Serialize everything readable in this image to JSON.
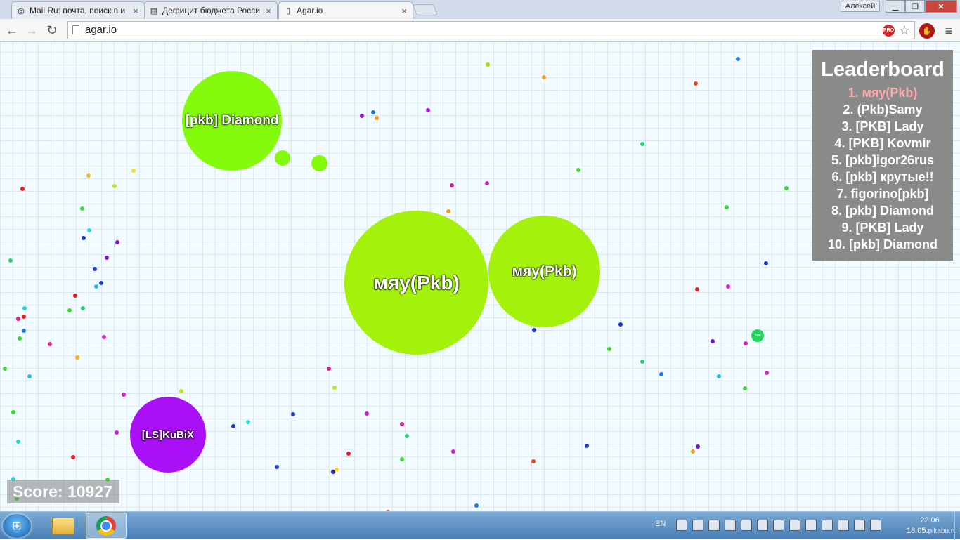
{
  "browser": {
    "tabs": [
      {
        "title": "Mail.Ru: почта, поиск в и",
        "active": false
      },
      {
        "title": "Дефицит бюджета Росси",
        "active": false
      },
      {
        "title": "Agar.io",
        "active": true
      }
    ],
    "profile_name": "Алексей",
    "url": "agar.io",
    "pro_badge": "PRO"
  },
  "game": {
    "cells": {
      "diamond": "[pkb] Diamond",
      "myau_big": "мяу(Pkb)",
      "myau_small": "мяу(Pkb)",
      "kubix": "[LS]KuBiX",
      "tiny": "Tim"
    },
    "leaderboard": {
      "title": "Leaderboard",
      "entries": [
        "1. мяу(Pkb)",
        "2. (Pkb)Samy",
        "3. [PKB] Lady",
        "4. [PKB] Kovmir",
        "5. [pkb]igor26rus",
        "6. [pkb] крутые!!",
        "7. figorino[pkb]",
        "8. [pkb] Diamond",
        "9. [PKB] Lady",
        "10. [pkb] Diamond"
      ]
    },
    "score": "Score: 10927",
    "colors": {
      "background": "#f2fbff",
      "grid": "#dce7ee",
      "green_cell": "#84fb0a",
      "lime_cell": "#a4f10c",
      "purple_cell": "#aa10f5",
      "leader_highlight": "#ffaaaa"
    }
  },
  "taskbar": {
    "language": "EN",
    "time": "22:06",
    "date": "18.05.",
    "watermark": "pikabu.ru"
  }
}
